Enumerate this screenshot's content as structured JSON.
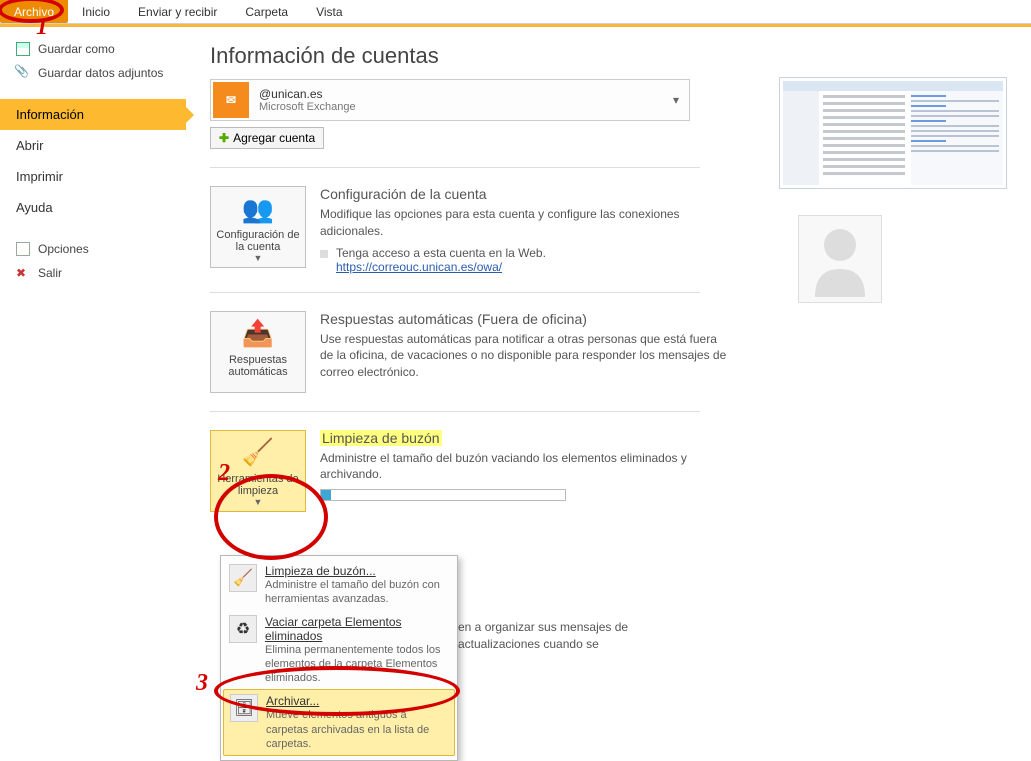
{
  "ribbon": {
    "tabs": [
      "Archivo",
      "Inicio",
      "Enviar y recibir",
      "Carpeta",
      "Vista"
    ]
  },
  "sidebar": {
    "save_as": "Guardar como",
    "save_attach": "Guardar datos adjuntos",
    "info": "Información",
    "open": "Abrir",
    "print": "Imprimir",
    "help": "Ayuda",
    "options": "Opciones",
    "exit": "Salir"
  },
  "page": {
    "title": "Información de cuentas",
    "account_email": "@unican.es",
    "account_type": "Microsoft Exchange",
    "add_account": "Agregar cuenta"
  },
  "sec_account": {
    "btn": "Configuración de la cuenta",
    "title": "Configuración de la cuenta",
    "desc": "Modifique las opciones para esta cuenta y configure las conexiones adicionales.",
    "bullet": "Tenga acceso a esta cuenta en la Web.",
    "link": "https://correouc.unican.es/owa/"
  },
  "sec_auto": {
    "btn": "Respuestas automáticas",
    "title": "Respuestas automáticas (Fuera de oficina)",
    "desc": "Use respuestas automáticas para notificar a otras personas que está fuera de la oficina, de vacaciones o no disponible para responder los mensajes de correo electrónico."
  },
  "sec_clean": {
    "btn": "Herramientas de limpieza",
    "title": "Limpieza de buzón",
    "desc": "Administre el tamaño del buzón vaciando los elementos eliminados y archivando."
  },
  "trail": {
    "l1": "en a organizar sus mensajes de",
    "l2": "actualizaciones cuando se"
  },
  "menu": {
    "m1_title": "Limpieza de buzón...",
    "m1_desc": "Administre el tamaño del buzón con herramientas avanzadas.",
    "m2_title": "Vaciar carpeta Elementos eliminados",
    "m2_desc": "Elimina permanentemente todos los elementos de la carpeta Elementos eliminados.",
    "m3_title": "Archivar...",
    "m3_desc": "Mueve elementos antiguos a carpetas archivadas en la lista de carpetas."
  },
  "anno": {
    "n1": "1",
    "n2": "2",
    "n3": "3"
  }
}
